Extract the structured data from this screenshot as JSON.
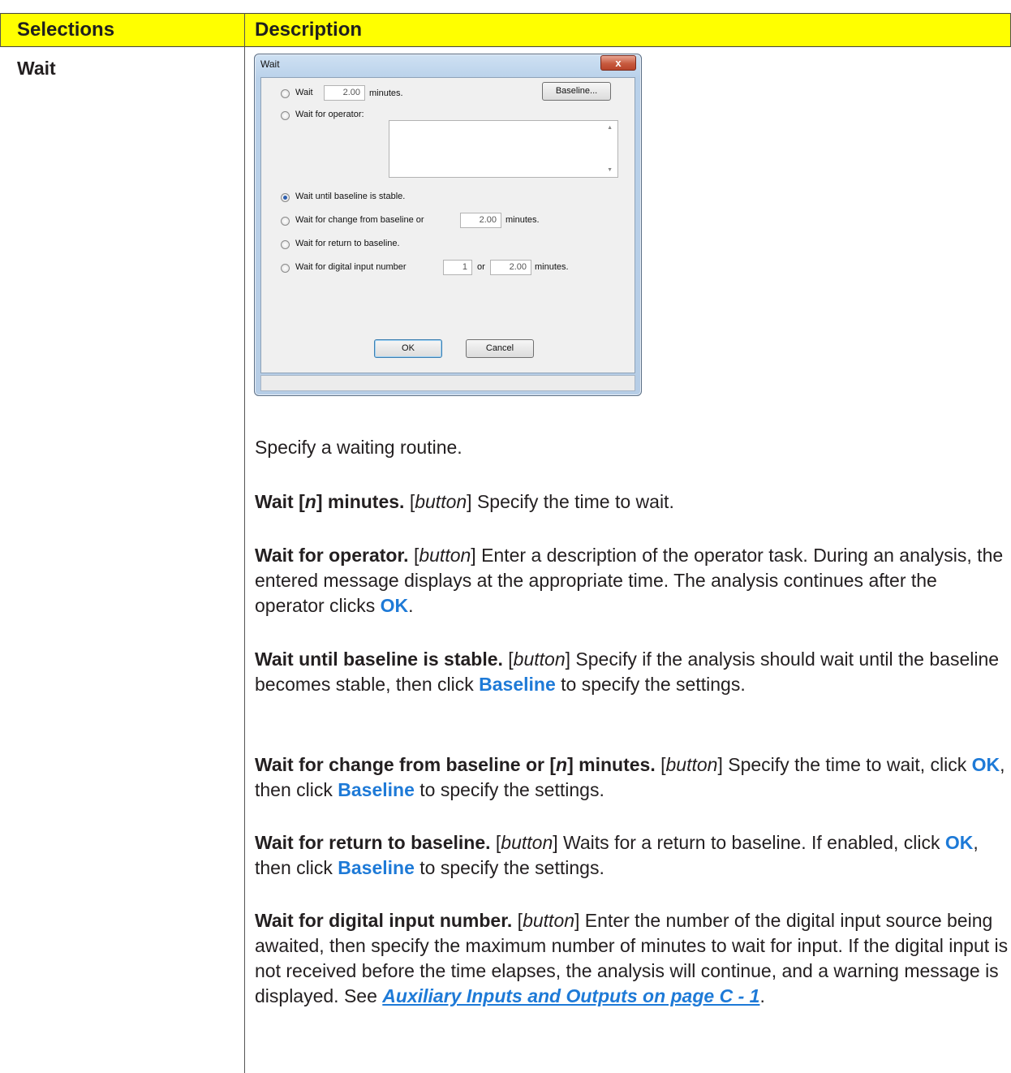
{
  "table": {
    "headers": [
      "Selections",
      "Description"
    ],
    "selection_label": "Wait"
  },
  "dialog": {
    "title": "Wait",
    "close_glyph": "x",
    "baseline_button": "Baseline...",
    "opt_wait": {
      "label": "Wait",
      "value": "2.00",
      "suffix": "minutes."
    },
    "opt_operator": {
      "label": "Wait for operator:"
    },
    "opt_stable": {
      "label": "Wait until baseline is stable.",
      "selected": true
    },
    "opt_change": {
      "label": "Wait for change from baseline or",
      "value": "2.00",
      "suffix": "minutes."
    },
    "opt_return": {
      "label": "Wait for return to baseline."
    },
    "opt_digital": {
      "label": "Wait for digital input number",
      "number": "1",
      "or": "or",
      "value": "2.00",
      "suffix": "minutes."
    },
    "ok_button": "OK",
    "cancel_button": "Cancel"
  },
  "description": {
    "intro": "Specify a waiting routine.",
    "p1": {
      "t1": "Wait [",
      "t2": "n",
      "t3": "] minutes.",
      "t4": " [",
      "t5": "button",
      "t6": "] Specify the time to wait."
    },
    "p2": {
      "t1": "Wait for operator.",
      "t2": " [",
      "t3": "button",
      "t4": "] Enter a description of the operator task. During an analysis, the entered message displays at the appropriate time. The analysis continues after the operator clicks ",
      "t5": "OK",
      "t6": "."
    },
    "p3": {
      "t1": "Wait until baseline is stable.",
      "t2": " [",
      "t3": "button",
      "t4": "] Specify if the analysis should wait until the baseline becomes stable,  then click ",
      "t5": "Baseline",
      "t6": "  to specify the settings."
    },
    "p4": {
      "t1": "Wait for change from baseline or [",
      "t2": "n",
      "t3": "] minutes.",
      "t4": " [",
      "t5": "button",
      "t6": "] Specify the time to wait, click ",
      "t7": "OK",
      "t8": ", then click ",
      "t9": "Baseline",
      "t10": " to specify the settings."
    },
    "p5": {
      "t1": "Wait for return to baseline.",
      "t2": " [",
      "t3": "button",
      "t4": "] Waits for a return to baseline. If enabled, click ",
      "t5": "OK",
      "t6": ", then click ",
      "t7": "Baseline",
      "t8": " to specify the settings."
    },
    "p6": {
      "t1": "Wait for digital input number.",
      "t2": " [",
      "t3": "button",
      "t4": "] Enter the number of the digital input source being awaited, then specify the maximum number of minutes to wait for input. If the digital input is not received before the time elapses, the analysis will continue, and a warning message is displayed. See ",
      "t5": "Auxiliary Inputs and Outputs on page C - 1",
      "t6": "."
    }
  }
}
